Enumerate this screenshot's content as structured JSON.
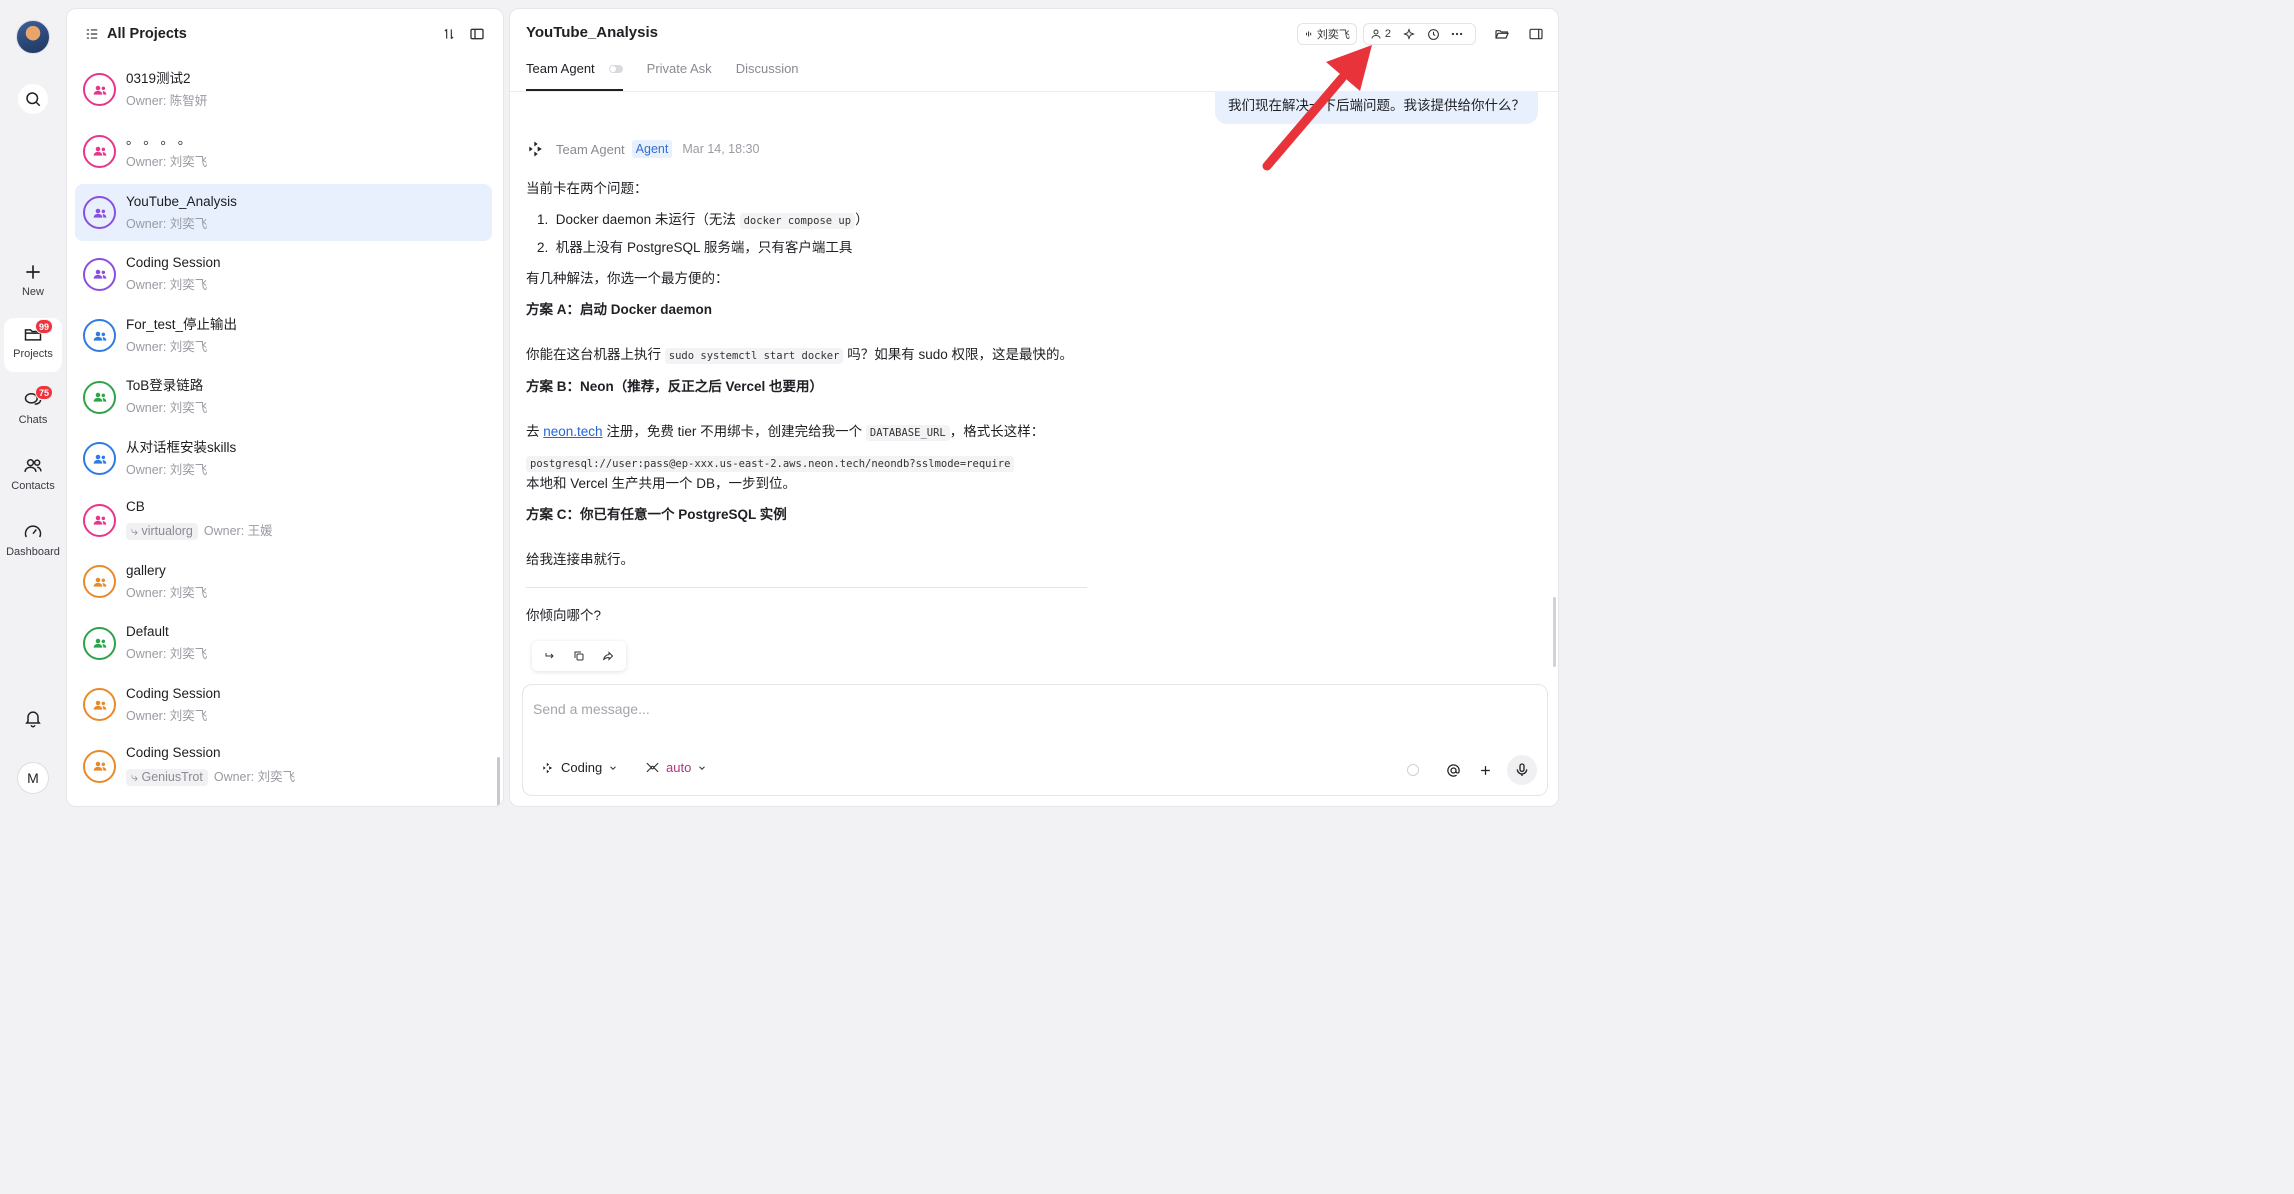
{
  "rail": {
    "new_label": "New",
    "projects_label": "Projects",
    "projects_badge": "99",
    "chats_label": "Chats",
    "chats_badge": "75",
    "contacts_label": "Contacts",
    "dashboard_label": "Dashboard",
    "me_initial": "M"
  },
  "projects_panel": {
    "title": "All Projects",
    "items": [
      {
        "name": "0319测试2",
        "tag": "",
        "owner": "Owner: 陈智妍",
        "color": "#e8358c"
      },
      {
        "name": "。 。 。 。",
        "tag": "",
        "owner": "Owner: 刘奕飞",
        "color": "#e8358c"
      },
      {
        "name": "YouTube_Analysis",
        "tag": "",
        "owner": "Owner: 刘奕飞",
        "color": "#8a4fe0"
      },
      {
        "name": "Coding Session",
        "tag": "",
        "owner": "Owner: 刘奕飞",
        "color": "#8a4fe0"
      },
      {
        "name": "For_test_停止输出",
        "tag": "",
        "owner": "Owner: 刘奕飞",
        "color": "#2f7be0"
      },
      {
        "name": "ToB登录链路",
        "tag": "",
        "owner": "Owner: 刘奕飞",
        "color": "#2ea34a"
      },
      {
        "name": "从对话框安装skills",
        "tag": "",
        "owner": "Owner: 刘奕飞",
        "color": "#2f7be0"
      },
      {
        "name": "CB",
        "tag": "⤷ virtualorg",
        "owner": "Owner: 王媛",
        "color": "#e8358c"
      },
      {
        "name": "gallery",
        "tag": "",
        "owner": "Owner: 刘奕飞",
        "color": "#e98a2a"
      },
      {
        "name": "Default",
        "tag": "",
        "owner": "Owner: 刘奕飞",
        "color": "#2ea34a"
      },
      {
        "name": "Coding Session",
        "tag": "",
        "owner": "Owner: 刘奕飞",
        "color": "#e98a2a"
      },
      {
        "name": "Coding Session",
        "tag": "⤷ GeniusTrot",
        "owner": "Owner: 刘奕飞",
        "color": "#e98a2a"
      }
    ]
  },
  "chat": {
    "title": "YouTube_Analysis",
    "user_pill": "刘奕飞",
    "members_count": "2",
    "tabs": [
      "Team Agent",
      "Private Ask",
      "Discussion"
    ],
    "user_message": "我们现在解决一下后端问题。我该提供给你什么？",
    "agent": {
      "name": "Team Agent",
      "tag": "Agent",
      "time": "Mar 14, 18:30",
      "p1": "当前卡在两个问题：",
      "li1_num": "1.",
      "li1_text": "Docker daemon 未运行（无法",
      "li1_code": "docker compose up",
      "li1_end": "）",
      "li2_num": "2.",
      "li2_text": "机器上没有 PostgreSQL 服务端，只有客户端工具",
      "p2": "有几种解法，你选一个最方便的：",
      "h_a": "方案 A：启动 Docker daemon",
      "a_text1": "你能在这台机器上执行",
      "a_code": "sudo systemctl start docker",
      "a_text2": "吗？如果有 sudo 权限，这是最快的。",
      "h_b": "方案 B：Neon（推荐，反正之后 Vercel 也要用）",
      "b_text1": "去",
      "b_link": "neon.tech",
      "b_text2": "注册，免费 tier 不用绑卡，创建完给我一个",
      "b_code": "DATABASE_URL",
      "b_text3": "，格式长这样：",
      "b_url_code": "postgresql://user:pass@ep-xxx.us-east-2.aws.neon.tech/neondb?sslmode=require",
      "b_text4": "本地和 Vercel 生产共用一个 DB，一步到位。",
      "h_c": "方案 C：你已有任意一个 PostgreSQL 实例",
      "c_text": "给我连接串就行。",
      "question": "你倾向哪个?"
    },
    "composer": {
      "placeholder": "Send a message...",
      "mode": "Coding",
      "model": "auto"
    }
  },
  "colors": {
    "accent_blue": "#2465d6",
    "selected_bg": "#e7f0fc",
    "badge_red": "#f0323c",
    "arrow_red": "#e8333a",
    "model_purple": "#b0367a"
  }
}
